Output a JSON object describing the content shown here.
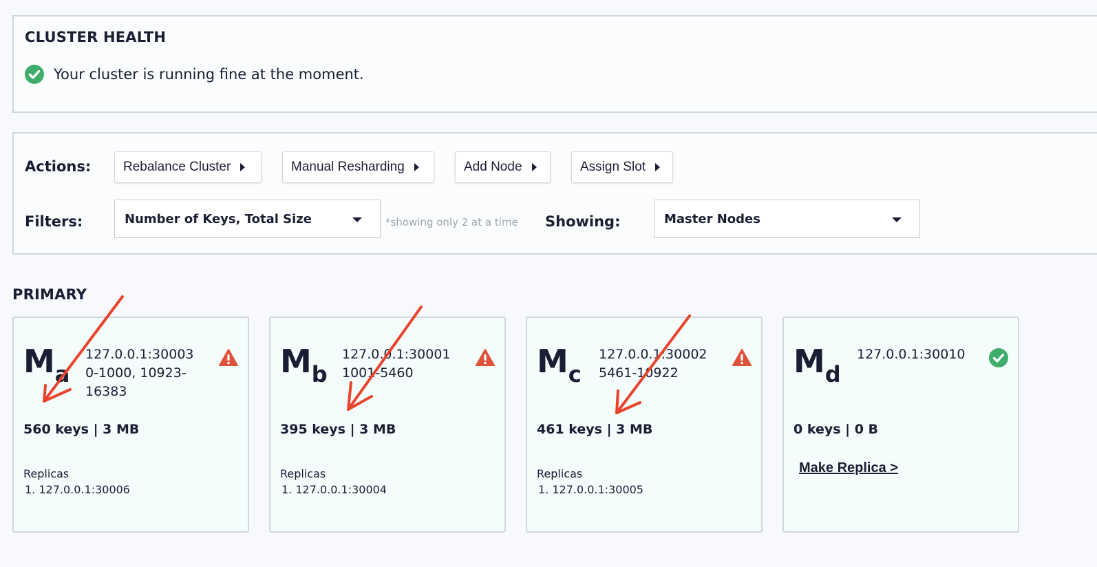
{
  "health": {
    "title": "CLUSTER HEALTH",
    "message": "Your cluster is running fine at the moment.",
    "status_icon": "check-circle-icon"
  },
  "actions": {
    "label": "Actions:",
    "buttons": [
      "Rebalance Cluster",
      "Manual Resharding",
      "Add Node",
      "Assign Slot"
    ]
  },
  "filters": {
    "label": "Filters:",
    "value": "Number of Keys, Total Size",
    "note": "*showing only 2 at a time"
  },
  "showing": {
    "label": "Showing:",
    "value": "Master Nodes"
  },
  "section_title": "PRIMARY",
  "colors": {
    "ok": "#3fae6a",
    "warning": "#e0523a",
    "annotation_arrow": "#e8442c"
  },
  "nodes": [
    {
      "letter": "M",
      "sub": "a",
      "addr1": "127.0.0.1:30003",
      "addr2": "0-1000, 10923-",
      "addr3": "16383",
      "stats": "560 keys | 3 MB",
      "status_icon": "warning-icon",
      "replicas_label": "Replicas",
      "replica": "1. 127.0.0.1:30006"
    },
    {
      "letter": "M",
      "sub": "b",
      "addr1": "127.0.0.1:30001",
      "addr2": "1001-5460",
      "addr3": "",
      "stats": "395 keys | 3 MB",
      "status_icon": "warning-icon",
      "replicas_label": "Replicas",
      "replica": "1. 127.0.0.1:30004"
    },
    {
      "letter": "M",
      "sub": "c",
      "addr1": "127.0.0.1:30002",
      "addr2": "5461-10922",
      "addr3": "",
      "stats": "461 keys | 3 MB",
      "status_icon": "warning-icon",
      "replicas_label": "Replicas",
      "replica": "1. 127.0.0.1:30005"
    },
    {
      "letter": "M",
      "sub": "d",
      "addr1": "127.0.0.1:30010",
      "addr2": "",
      "addr3": "",
      "stats": "0 keys | 0 B",
      "status_icon": "check-circle-icon",
      "make_replica": "Make Replica >"
    }
  ]
}
